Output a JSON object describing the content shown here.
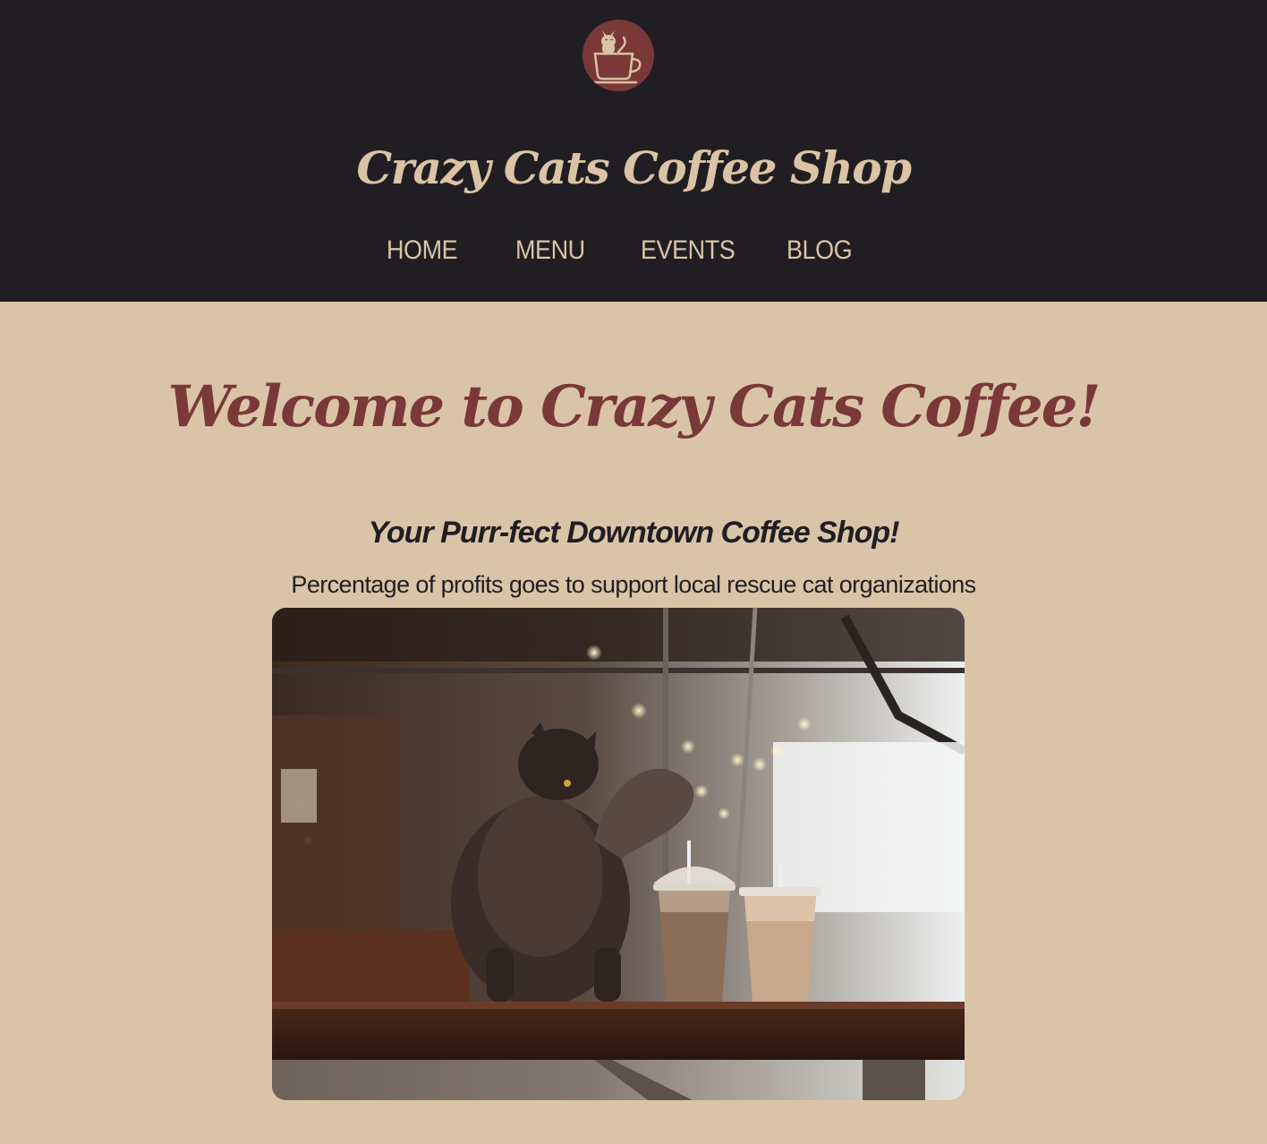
{
  "header": {
    "logo_icon": "cat-in-coffee-cup-icon",
    "title": "Crazy Cats Coffee Shop",
    "nav": [
      {
        "label": "HOME"
      },
      {
        "label": "MENU"
      },
      {
        "label": "EVENTS"
      },
      {
        "label": "BLOG"
      }
    ]
  },
  "main": {
    "welcome": "Welcome to Crazy Cats Coffee!",
    "tagline": "Your Purr-fect Downtown Coffee Shop!",
    "subline": "Percentage of profits goes to support local rescue cat organizations",
    "hero_image": "fluffy-cat-with-iced-coffees-photo"
  },
  "colors": {
    "header_bg": "#201e22",
    "page_bg": "#dac4a8",
    "accent": "#7a3838",
    "light_text": "#dbc3a4",
    "dark_text": "#201e22"
  }
}
